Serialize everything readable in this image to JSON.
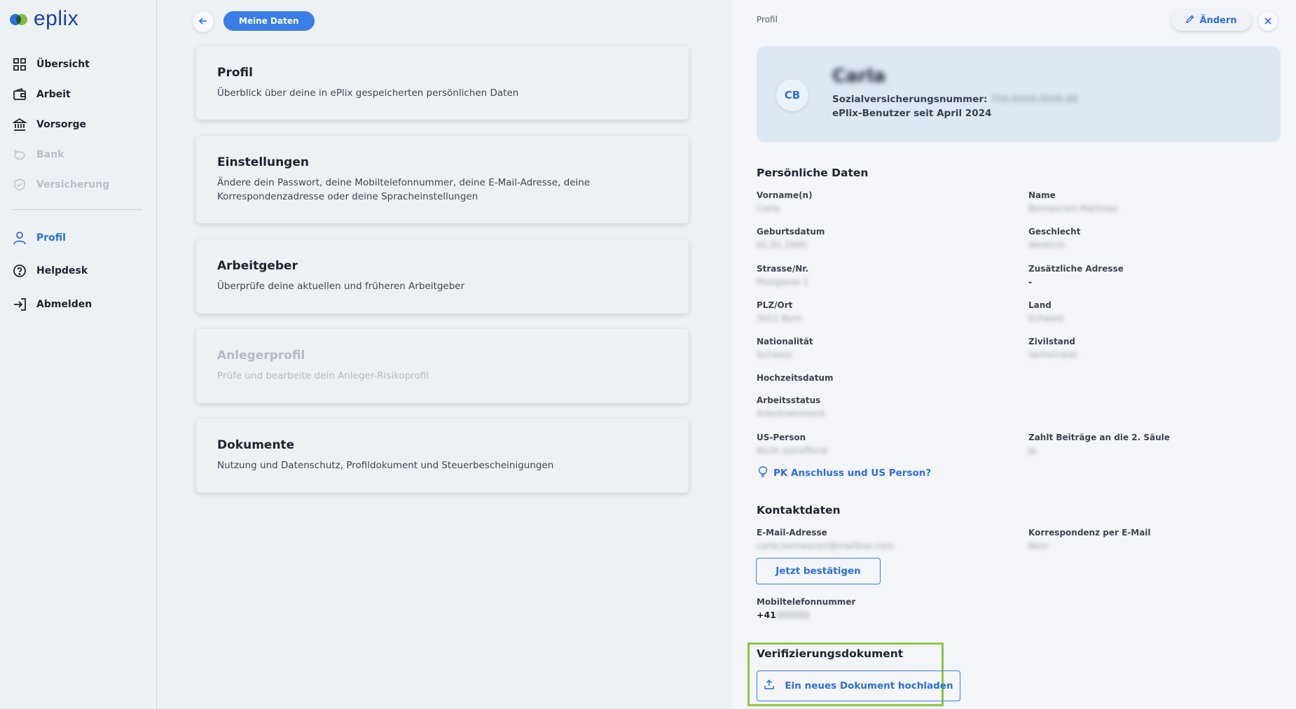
{
  "brand": {
    "name": "eplix"
  },
  "sidebar": {
    "items": [
      {
        "label": "Übersicht",
        "icon": "grid-icon"
      },
      {
        "label": "Arbeit",
        "icon": "wallet-icon"
      },
      {
        "label": "Vorsorge",
        "icon": "bank-icon"
      },
      {
        "label": "Bank",
        "icon": "piggy-bank-icon"
      },
      {
        "label": "Versicherung",
        "icon": "shield-icon"
      },
      {
        "label": "Profil",
        "icon": "user-icon"
      },
      {
        "label": "Helpdesk",
        "icon": "help-icon"
      },
      {
        "label": "Abmelden",
        "icon": "logout-icon"
      }
    ]
  },
  "middle": {
    "pill_label": "Meine Daten",
    "cards": [
      {
        "title": "Profil",
        "desc": "Überblick über deine in ePlix gespeicherten persönlichen Daten"
      },
      {
        "title": "Einstellungen",
        "desc": "Ändere dein Passwort, deine Mobiltelefonnummer, deine E-Mail-Adresse, deine Korrespondenzadresse oder deine Spracheinstellungen"
      },
      {
        "title": "Arbeitgeber",
        "desc": "Überprüfe deine aktuellen und früheren Arbeitgeber"
      },
      {
        "title": "Anlegerprofil",
        "desc": "Prüfe und bearbeite dein Anleger-Risikoprofil"
      },
      {
        "title": "Dokumente",
        "desc": "Nutzung und Datenschutz, Profildokument und Steuerbescheinigungen"
      }
    ]
  },
  "panel": {
    "breadcrumb": "Profil",
    "edit_label": "Ändern",
    "profile": {
      "initials": "CB",
      "name": "Carla",
      "ssn_label": "Sozialversicherungsnummer:",
      "ssn_value": "756.0000.0000.00",
      "since": "ePlix-Benutzer seit April 2024"
    },
    "personal": {
      "title": "Persönliche Daten",
      "fields": {
        "vorname": {
          "label": "Vorname(n)",
          "value": "Carla"
        },
        "name": {
          "label": "Name",
          "value": "Bernasconi Martinez"
        },
        "geburtsdatum": {
          "label": "Geburtsdatum",
          "value": "01.01.1990"
        },
        "geschlecht": {
          "label": "Geschlecht",
          "value": "Weiblich"
        },
        "strasse": {
          "label": "Strasse/Nr.",
          "value": "Postgasse 1"
        },
        "zusatz": {
          "label": "Zusätzliche Adresse",
          "value": "-"
        },
        "plz": {
          "label": "PLZ/Ort",
          "value": "3011 Bern"
        },
        "land": {
          "label": "Land",
          "value": "Schweiz"
        },
        "nationalitaet": {
          "label": "Nationalität",
          "value": "Schweiz"
        },
        "zivilstand": {
          "label": "Zivilstand",
          "value": "Verheiratet"
        },
        "hochzeit": {
          "label": "Hochzeitsdatum"
        },
        "arbeitsstatus": {
          "label": "Arbeitsstatus",
          "value": "Arbeitnehmend"
        },
        "usperson": {
          "label": "US-Person",
          "value": "Nicht zutreffend"
        },
        "beitraege": {
          "label": "Zahlt Beiträge an die 2. Säule",
          "value": "Ja"
        }
      },
      "link": "PK Anschluss und US Person?"
    },
    "contact": {
      "title": "Kontaktdaten",
      "email_label": "E-Mail-Adresse",
      "email_value": "carla.bernasconi@mailbox.com",
      "corr_label": "Korrespondenz per E-Mail",
      "corr_value": "Nein",
      "confirm_label": "Jetzt bestätigen",
      "mobile_label": "Mobiltelefonnummer",
      "mobile_prefix": "+41",
      "mobile_rest": "000000"
    },
    "verification": {
      "title": "Verifizierungsdokument",
      "upload_label": "Ein neues Dokument hochladen"
    }
  },
  "colors": {
    "accent": "#3a7ee6",
    "highlight": "#8cc63f",
    "profile_bg": "#dde8f3"
  }
}
